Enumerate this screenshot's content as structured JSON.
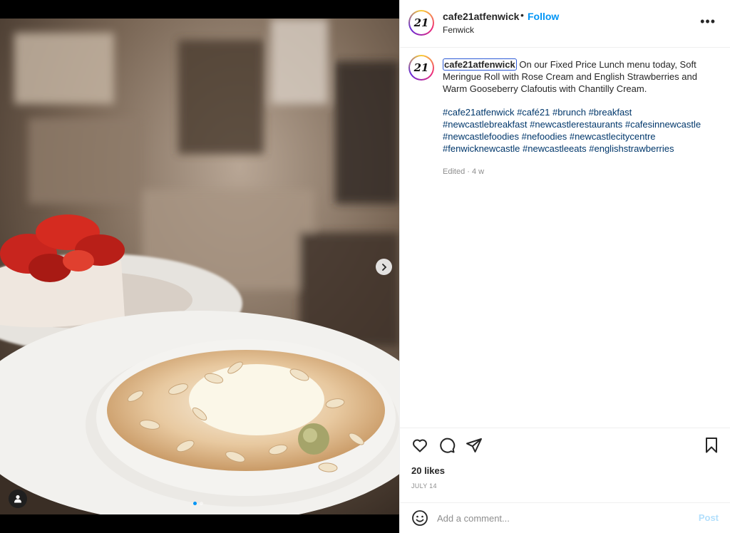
{
  "post": {
    "username": "cafe21atfenwick",
    "separator": "•",
    "follow_label": "Follow",
    "location": "Fenwick",
    "avatar_text": "21",
    "more_label": "•••"
  },
  "caption": {
    "username": "cafe21atfenwick",
    "text": " On our Fixed Price Lunch menu today, Soft Meringue Roll with Rose Cream and English Strawberries and Warm Gooseberry Clafoutis with Chantilly Cream.",
    "hashtags": [
      "#cafe21atfenwick",
      "#café21",
      "#brunch",
      "#breakfast",
      "#newcastlebreakfast",
      "#newcastlerestaurants",
      "#cafesinnewcastle",
      "#newcastlefoodies",
      "#nefoodies",
      "#newcastlecitycentre",
      "#fenwicknewcastle",
      "#newcastleeats",
      "#englishstrawberries"
    ],
    "meta": "Edited · 4 w"
  },
  "stats": {
    "likes": "20 likes",
    "date": "JULY 14"
  },
  "comment_box": {
    "placeholder": "Add a comment...",
    "post_label": "Post"
  },
  "carousel": {
    "slide": 1,
    "total": 2
  },
  "colors": {
    "accent": "#0095f6",
    "hashtag": "#00376b",
    "muted": "#8e8e8e"
  },
  "icons": [
    "heart-icon",
    "comment-icon",
    "share-icon",
    "bookmark-icon",
    "emoji-icon",
    "chevron-right-icon",
    "user-tag-icon",
    "more-icon"
  ]
}
